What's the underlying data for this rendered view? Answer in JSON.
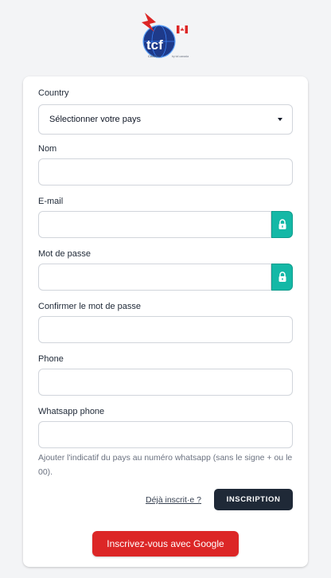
{
  "brand": {
    "logo_text": "tcf",
    "logo_subtext": "CANADA",
    "logo_tagline": "by tcf-canada"
  },
  "form": {
    "country_label": "Country",
    "country_selected": "Sélectionner votre pays",
    "name_label": "Nom",
    "email_label": "E-mail",
    "password_label": "Mot de passe",
    "confirm_password_label": "Confirmer le mot de passe",
    "phone_label": "Phone",
    "whatsapp_label": "Whatsapp phone",
    "whatsapp_help": "Ajouter l'indicatif du pays au numéro whatsapp (sans le signe + ou le 00)."
  },
  "actions": {
    "already_registered_link": "Déjà inscrit·e ?",
    "register_button": "INSCRIPTION",
    "google_button": "Inscrivez-vous avec Google"
  },
  "icons": {
    "lock": "lock-icon",
    "caret": "chevron-down-icon"
  },
  "colors": {
    "accent_teal": "#14b8a6",
    "dark_button": "#1f2937",
    "google_red": "#dc2626"
  }
}
